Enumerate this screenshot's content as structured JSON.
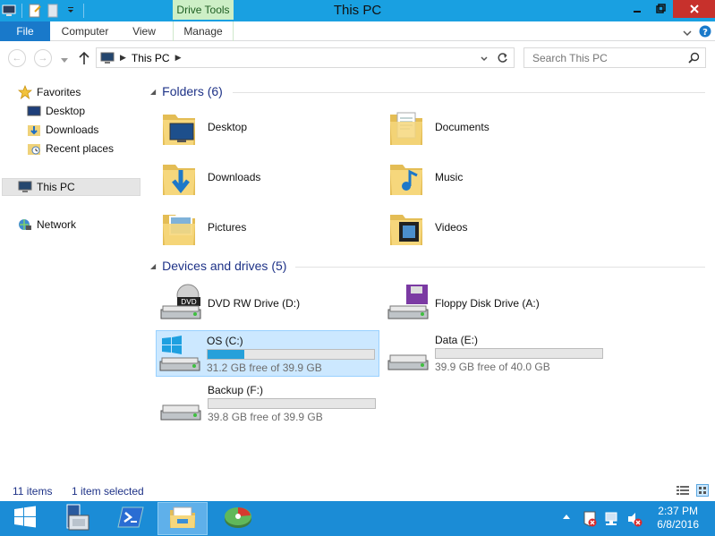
{
  "window": {
    "title": "This PC",
    "context_tab_group": "Drive Tools",
    "accent": "#19a0e1"
  },
  "ribbon": {
    "tabs": [
      {
        "label": "File"
      },
      {
        "label": "Computer"
      },
      {
        "label": "View"
      },
      {
        "label": "Manage"
      }
    ]
  },
  "address": {
    "path": "This PC",
    "search_placeholder": "Search This PC"
  },
  "nav": {
    "favorites": "Favorites",
    "items": [
      "Desktop",
      "Downloads",
      "Recent places"
    ],
    "this_pc": "This PC",
    "network": "Network"
  },
  "folders": {
    "header": "Folders (6)",
    "items": [
      "Desktop",
      "Documents",
      "Downloads",
      "Music",
      "Pictures",
      "Videos"
    ]
  },
  "drives": {
    "header": "Devices and drives (5)",
    "items": [
      {
        "name": "DVD RW Drive (D:)",
        "icon": "dvd-drive-icon"
      },
      {
        "name": "Floppy Disk Drive (A:)",
        "icon": "floppy-drive-icon"
      },
      {
        "name": "OS (C:)",
        "free": "31.2 GB free of 39.9 GB",
        "used_fraction": 0.22,
        "selected": true,
        "icon": "windows-drive-icon"
      },
      {
        "name": "Data (E:)",
        "free": "39.9 GB free of 40.0 GB",
        "used_fraction": 0.0,
        "icon": "hard-drive-icon"
      },
      {
        "name": "Backup (F:)",
        "free": "39.8 GB free of 39.9 GB",
        "used_fraction": 0.0,
        "icon": "hard-drive-icon"
      }
    ]
  },
  "status": {
    "count": "11 items",
    "selected": "1 item selected"
  },
  "taskbar": {
    "time": "2:37 PM",
    "date": "6/8/2016"
  }
}
